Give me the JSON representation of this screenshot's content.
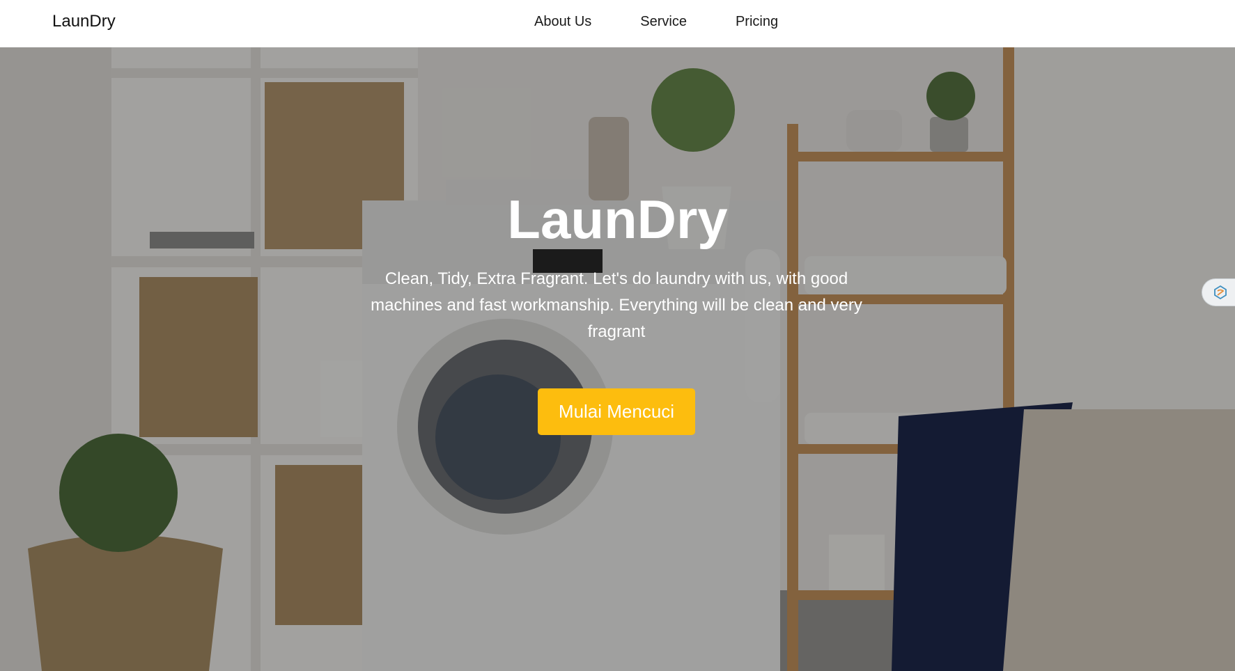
{
  "navbar": {
    "brand": "LaunDry",
    "links": [
      {
        "label": "About Us"
      },
      {
        "label": "Service"
      },
      {
        "label": "Pricing"
      }
    ]
  },
  "hero": {
    "title": "LaunDry",
    "subtitle": "Clean, Tidy, Extra Fragrant. Let's do laundry with us, with good machines and fast workmanship. Everything will be clean and very fragrant",
    "cta_label": "Mulai Mencuci",
    "background_icon": "laundry-room-photo"
  },
  "side_widget": {
    "icon": "extension-icon"
  },
  "colors": {
    "cta": "#fdbd0e",
    "navbar_bg": "#ffffff",
    "overlay": "rgba(0,0,0,0.34)",
    "hero_text": "#ffffff"
  }
}
